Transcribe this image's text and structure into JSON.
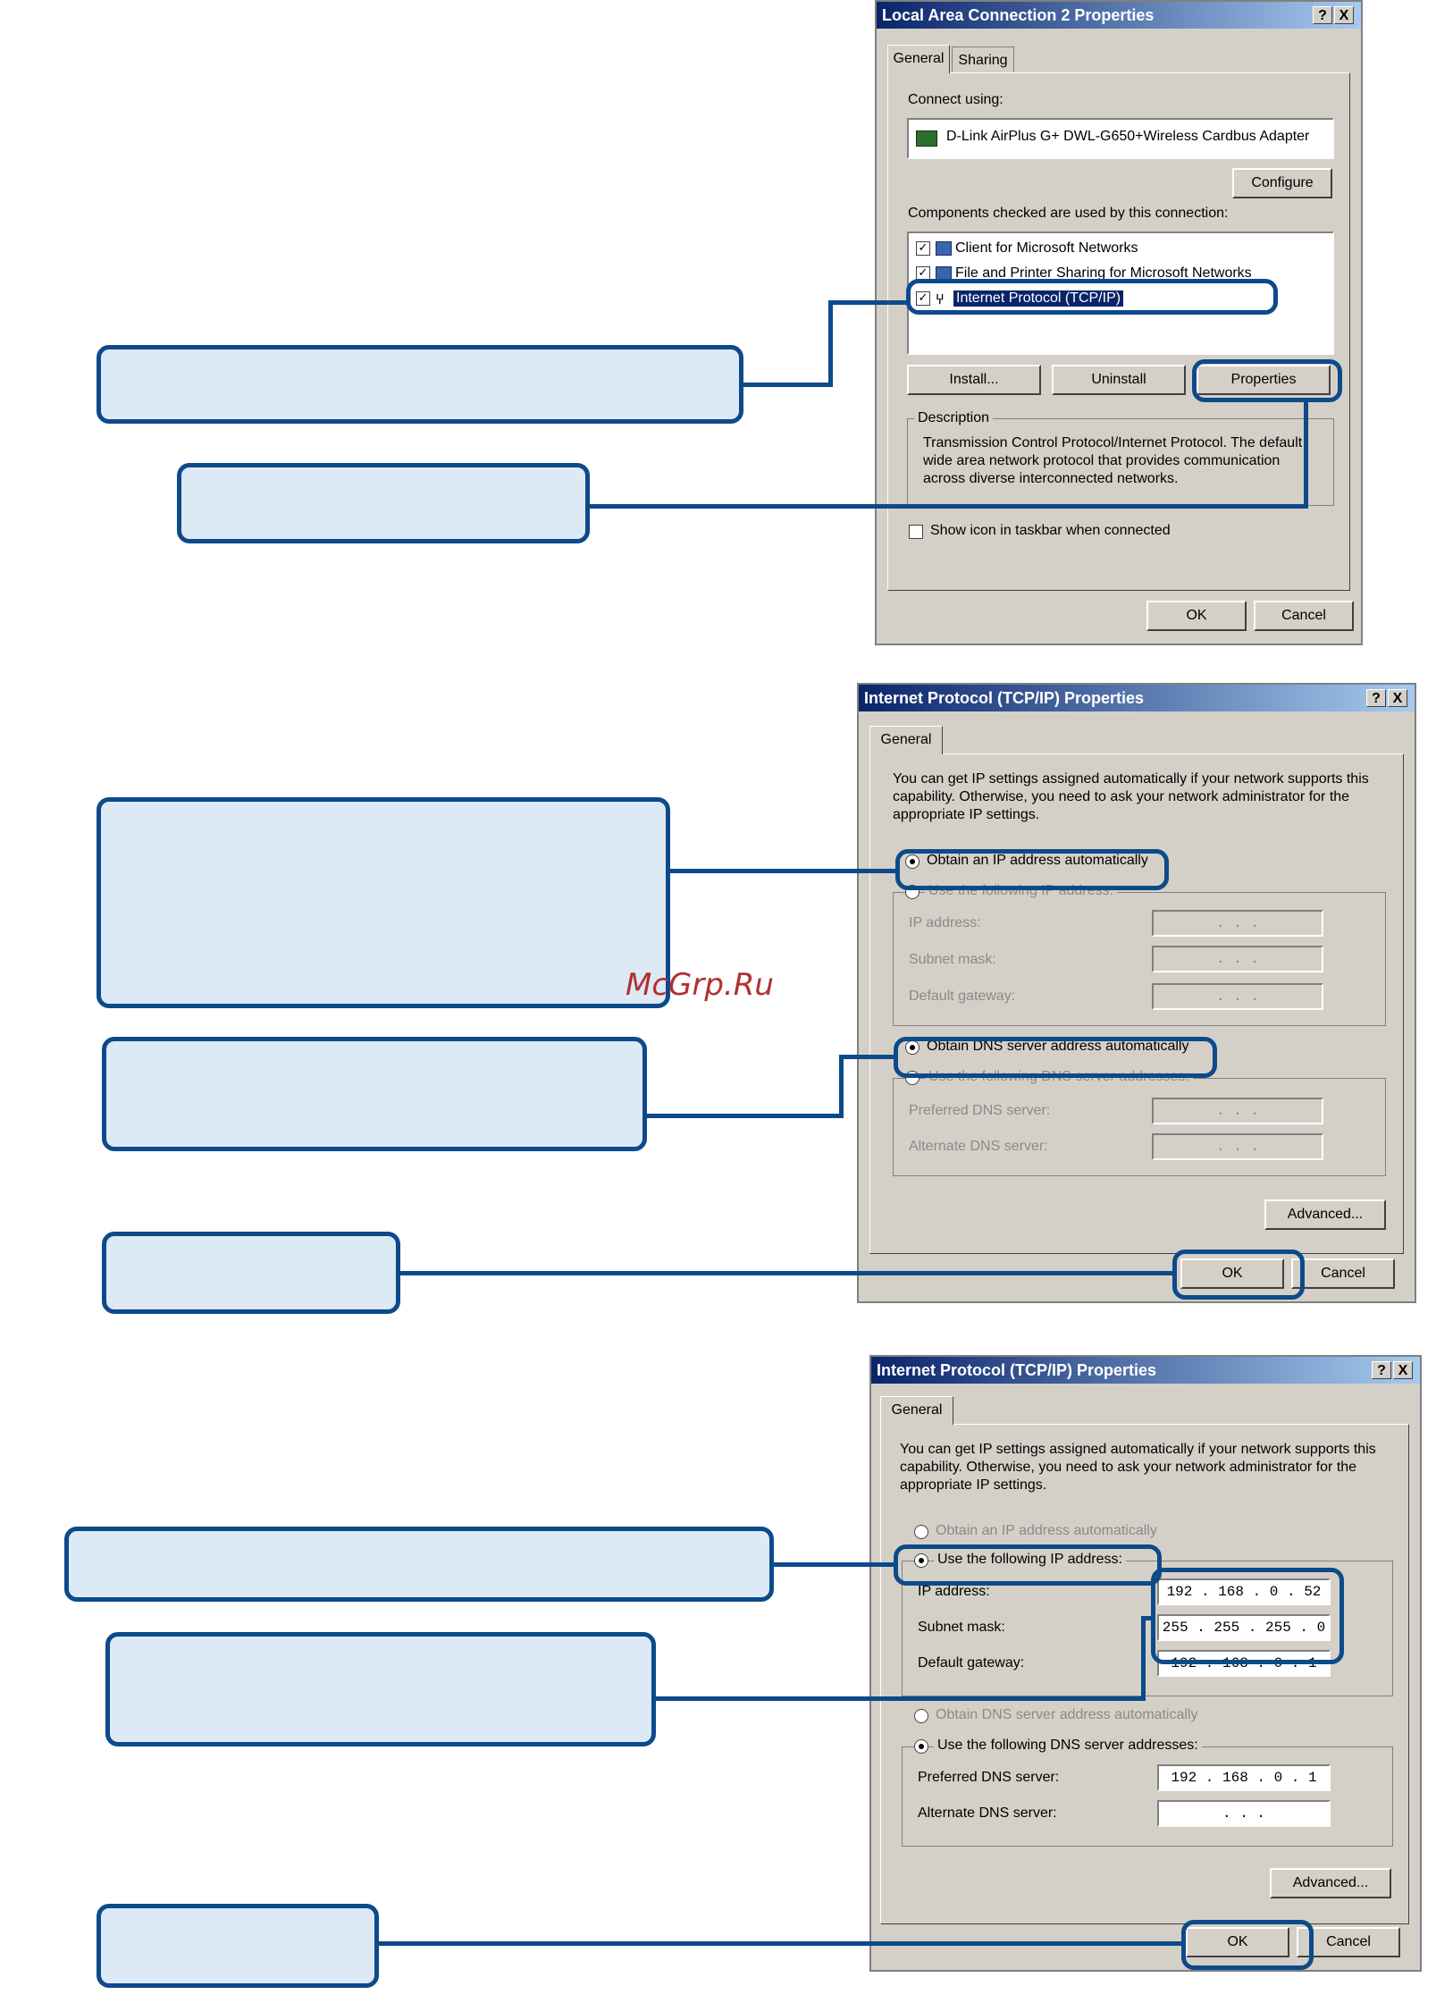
{
  "dialog1": {
    "title": "Local Area Connection 2 Properties",
    "help_btn": "?",
    "close_btn": "X",
    "tabs": [
      "General",
      "Sharing"
    ],
    "connect_using_label": "Connect using:",
    "adapter_name": "D-Link AirPlus G+ DWL-G650+Wireless Cardbus Adapter",
    "configure_label": "Configure",
    "components_label": "Components checked are used by this connection:",
    "components": [
      {
        "label": "Client for Microsoft Networks",
        "checked": true
      },
      {
        "label": "File and Printer Sharing for Microsoft Networks",
        "checked": true
      },
      {
        "label": "Internet Protocol (TCP/IP)",
        "checked": true,
        "selected": true
      }
    ],
    "install_label": "Install...",
    "uninstall_label": "Uninstall",
    "properties_label": "Properties",
    "description_label": "Description",
    "description_text": "Transmission Control Protocol/Internet Protocol. The default wide area network protocol that provides communication across diverse interconnected networks.",
    "show_icon_label": "Show icon in taskbar when connected",
    "ok_label": "OK",
    "cancel_label": "Cancel"
  },
  "dialog2": {
    "title": "Internet Protocol (TCP/IP) Properties",
    "help_btn": "?",
    "close_btn": "X",
    "tab": "General",
    "intro": "You can get IP settings assigned automatically if your network supports this capability. Otherwise, you need to ask your network administrator for the appropriate IP settings.",
    "obtain_ip_label": "Obtain an IP address automatically",
    "use_ip_label": "Use the following IP address:",
    "ip_label": "IP address:",
    "subnet_label": "Subnet mask:",
    "gateway_label": "Default gateway:",
    "empty_ip": ".   .   .",
    "obtain_dns_label": "Obtain DNS server address automatically",
    "use_dns_label": "Use the following DNS server addresses:",
    "pref_dns_label": "Preferred DNS server:",
    "alt_dns_label": "Alternate DNS server:",
    "advanced_label": "Advanced...",
    "ok_label": "OK",
    "cancel_label": "Cancel"
  },
  "dialog3": {
    "title": "Internet Protocol (TCP/IP) Properties",
    "help_btn": "?",
    "close_btn": "X",
    "tab": "General",
    "intro": "You can get IP settings assigned automatically if your network supports this capability. Otherwise, you need to ask your network administrator for the appropriate IP settings.",
    "obtain_ip_label": "Obtain an IP address automatically",
    "use_ip_label": "Use the following IP address:",
    "ip_label": "IP address:",
    "ip_value": "192 . 168 .  0  . 52",
    "subnet_label": "Subnet mask:",
    "subnet_value": "255 . 255 . 255 .  0",
    "gateway_label": "Default gateway:",
    "gateway_value": "192 . 168 .  0  .  1",
    "obtain_dns_label": "Obtain DNS server address automatically",
    "use_dns_label": "Use the following DNS server addresses:",
    "pref_dns_label": "Preferred DNS server:",
    "pref_dns_value": "192 . 168 .  0  .  1",
    "alt_dns_label": "Alternate DNS server:",
    "alt_dns_value": ".   .   .",
    "advanced_label": "Advanced...",
    "ok_label": "OK",
    "cancel_label": "Cancel"
  },
  "watermark": "McGrp.Ru"
}
